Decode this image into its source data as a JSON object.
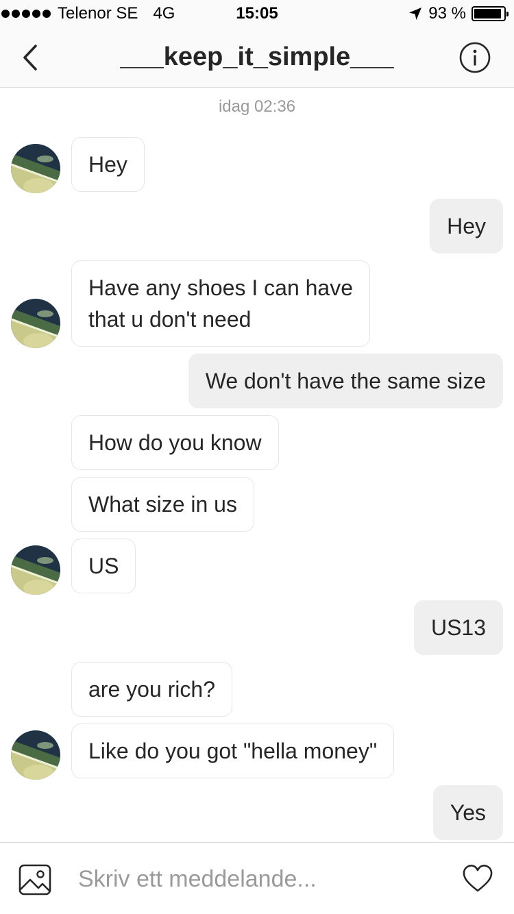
{
  "status_bar": {
    "carrier": "Telenor SE",
    "network": "4G",
    "time": "15:05",
    "battery_percent": "93 %",
    "battery_level": 0.93,
    "signal_icon": "signal-dots-icon",
    "location_icon": "location-arrow-icon",
    "battery_icon": "battery-icon"
  },
  "header": {
    "title": "___keep_it_simple___",
    "back_icon": "chevron-left-icon",
    "info_icon": "info-icon"
  },
  "conversation": {
    "timestamp": "idag 02:36",
    "messages": [
      {
        "sender": "them",
        "text": "Hey"
      },
      {
        "sender": "me",
        "text": "Hey"
      },
      {
        "sender": "them",
        "lines": [
          "Have  any shoes I can have",
          "that u don't need"
        ]
      },
      {
        "sender": "me",
        "text": "We don't have the same size"
      },
      {
        "sender": "them",
        "text": "How do you know"
      },
      {
        "sender": "them",
        "text": "What size in us"
      },
      {
        "sender": "them",
        "text": "US"
      },
      {
        "sender": "me",
        "text": "US13"
      },
      {
        "sender": "them",
        "text": "are you rich?"
      },
      {
        "sender": "them",
        "text": "Like do you got \"hella money\""
      },
      {
        "sender": "me",
        "text": "Yes"
      }
    ]
  },
  "composer": {
    "placeholder": "Skriv ett meddelande...",
    "gallery_icon": "image-gallery-icon",
    "like_icon": "heart-icon"
  },
  "colors": {
    "background": "#ffffff",
    "bar_background": "#fafafa",
    "outgoing_bubble": "#efefef",
    "incoming_border": "#e6e6e6",
    "text": "#262626",
    "muted_text": "#999999"
  }
}
